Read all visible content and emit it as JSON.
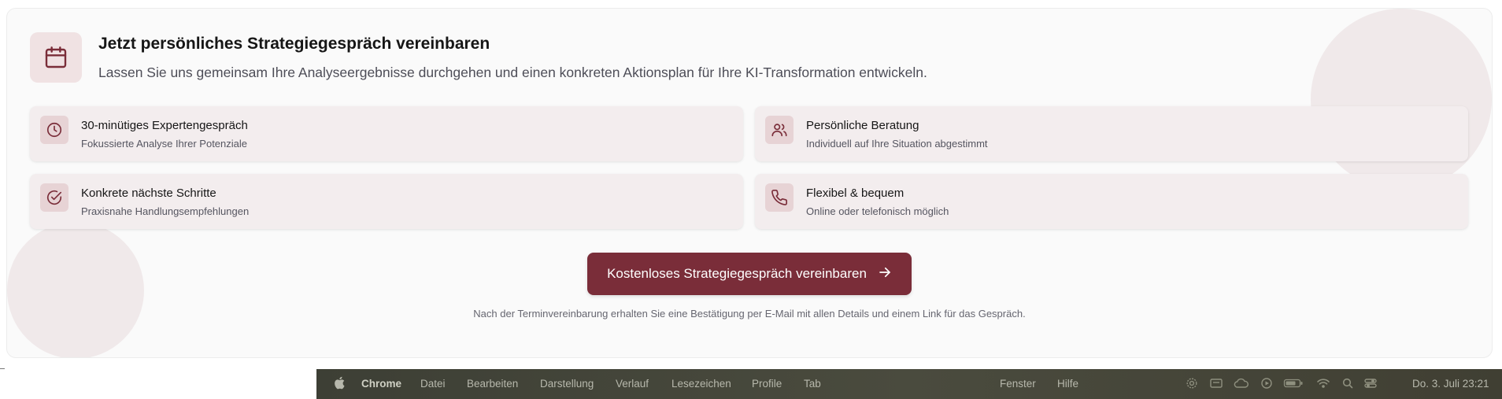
{
  "header": {
    "title": "Jetzt persönliches Strategiegespräch vereinbaren",
    "subtitle": "Lassen Sie uns gemeinsam Ihre Analyseergebnisse durchgehen und einen konkreten Aktionsplan für Ihre KI-Transformation entwickeln.",
    "icon": "calendar-icon"
  },
  "features": [
    {
      "title": "30-minütiges Expertengespräch",
      "description": "Fokussierte Analyse Ihrer Potenziale",
      "icon": "clock-icon"
    },
    {
      "title": "Persönliche Beratung",
      "description": "Individuell auf Ihre Situation abgestimmt",
      "icon": "users-icon"
    },
    {
      "title": "Konkrete nächste Schritte",
      "description": "Praxisnahe Handlungsempfehlungen",
      "icon": "check-circle-icon"
    },
    {
      "title": "Flexibel & bequem",
      "description": "Online oder telefonisch möglich",
      "icon": "phone-icon"
    }
  ],
  "cta": {
    "label": "Kostenloses Strategiegespräch vereinbaren",
    "icon": "arrow-right-icon"
  },
  "note": "Nach der Terminvereinbarung erhalten Sie eine Bestätigung per E-Mail mit allen Details und einem Link für das Gespräch.",
  "menubar": {
    "app": "Chrome",
    "items": [
      "Datei",
      "Bearbeiten",
      "Darstellung",
      "Verlauf",
      "Lesezeichen",
      "Profile",
      "Tab",
      "Fenster",
      "Hilfe"
    ],
    "datetime": "Do. 3. Juli  23:21"
  },
  "colors": {
    "accent": "#7a2d39",
    "icon_tile": "#e7d3d5",
    "feature_bg": "#f3edee",
    "menubar_bg": "#45463a"
  }
}
